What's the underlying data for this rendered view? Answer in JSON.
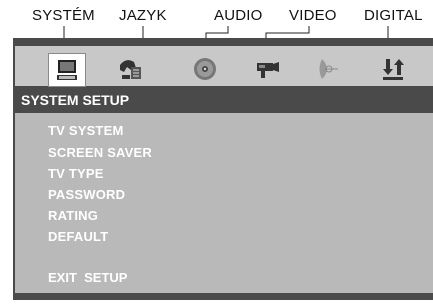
{
  "top_labels": [
    "SYSTÉM",
    "JAZYK",
    "AUDIO",
    "VIDEO",
    "DIGITAL"
  ],
  "tabs": [
    {
      "name": "system",
      "icon": "monitor-icon"
    },
    {
      "name": "language",
      "icon": "language-icon"
    },
    {
      "name": "audio",
      "icon": "disc-icon"
    },
    {
      "name": "video",
      "icon": "video-camera-icon"
    },
    {
      "name": "speaker",
      "icon": "speaker-icon"
    },
    {
      "name": "digital",
      "icon": "digital-output-icon"
    }
  ],
  "header": {
    "title": "SYSTEM SETUP"
  },
  "menu": [
    "TV SYSTEM",
    "SCREEN SAVER",
    "TV TYPE",
    "PASSWORD",
    "RATING",
    "DEFAULT"
  ],
  "footer": {
    "exit_label": "EXIT  SETUP"
  },
  "colors": {
    "frame": "#4a4a4a",
    "tabbar": "#c8c8c8",
    "panel": "#b9b9b9",
    "text": "#ffffff"
  }
}
